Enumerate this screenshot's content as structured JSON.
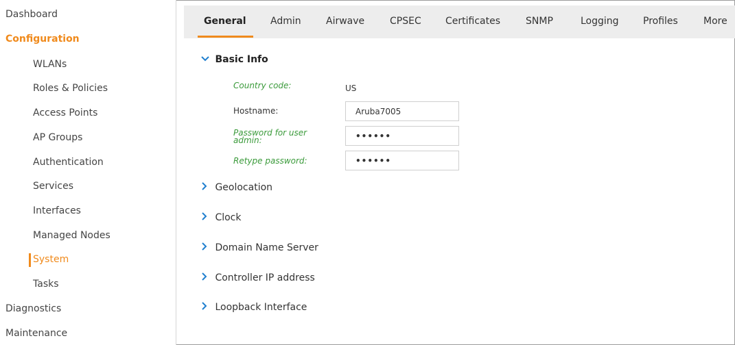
{
  "sidebar": {
    "top_items": [
      {
        "label": "Dashboard"
      },
      {
        "label": "Configuration"
      },
      {
        "label": "Diagnostics"
      },
      {
        "label": "Maintenance"
      }
    ],
    "config_items": [
      {
        "label": "WLANs"
      },
      {
        "label": "Roles & Policies"
      },
      {
        "label": "Access Points"
      },
      {
        "label": "AP Groups"
      },
      {
        "label": "Authentication"
      },
      {
        "label": "Services"
      },
      {
        "label": "Interfaces"
      },
      {
        "label": "Managed Nodes"
      },
      {
        "label": "System"
      },
      {
        "label": "Tasks"
      }
    ],
    "active_item": "System"
  },
  "tabs": [
    {
      "label": "General"
    },
    {
      "label": "Admin"
    },
    {
      "label": "Airwave"
    },
    {
      "label": "CPSEC"
    },
    {
      "label": "Certificates"
    },
    {
      "label": "SNMP"
    },
    {
      "label": "Logging"
    },
    {
      "label": "Profiles"
    },
    {
      "label": "More"
    }
  ],
  "active_tab": "General",
  "basic_info": {
    "title": "Basic Info",
    "country_code_label": "Country code:",
    "country_code_value": "US",
    "hostname_label": "Hostname:",
    "hostname_value": "Aruba7005",
    "password_label": "Password for user admin:",
    "password_value": "••••••",
    "retype_label": "Retype password:",
    "retype_value": "••••••"
  },
  "sections": [
    {
      "label": "Geolocation"
    },
    {
      "label": "Clock"
    },
    {
      "label": "Domain Name Server"
    },
    {
      "label": "Controller IP address"
    },
    {
      "label": "Loopback Interface"
    }
  ],
  "icons": {
    "expanded": "chevron-down-icon",
    "collapsed": "chevron-right-icon"
  },
  "colors": {
    "accent": "#f08a1c",
    "link": "#1f7fcf",
    "required_label": "#3a9a3a",
    "tabbar_bg": "#ededed"
  }
}
